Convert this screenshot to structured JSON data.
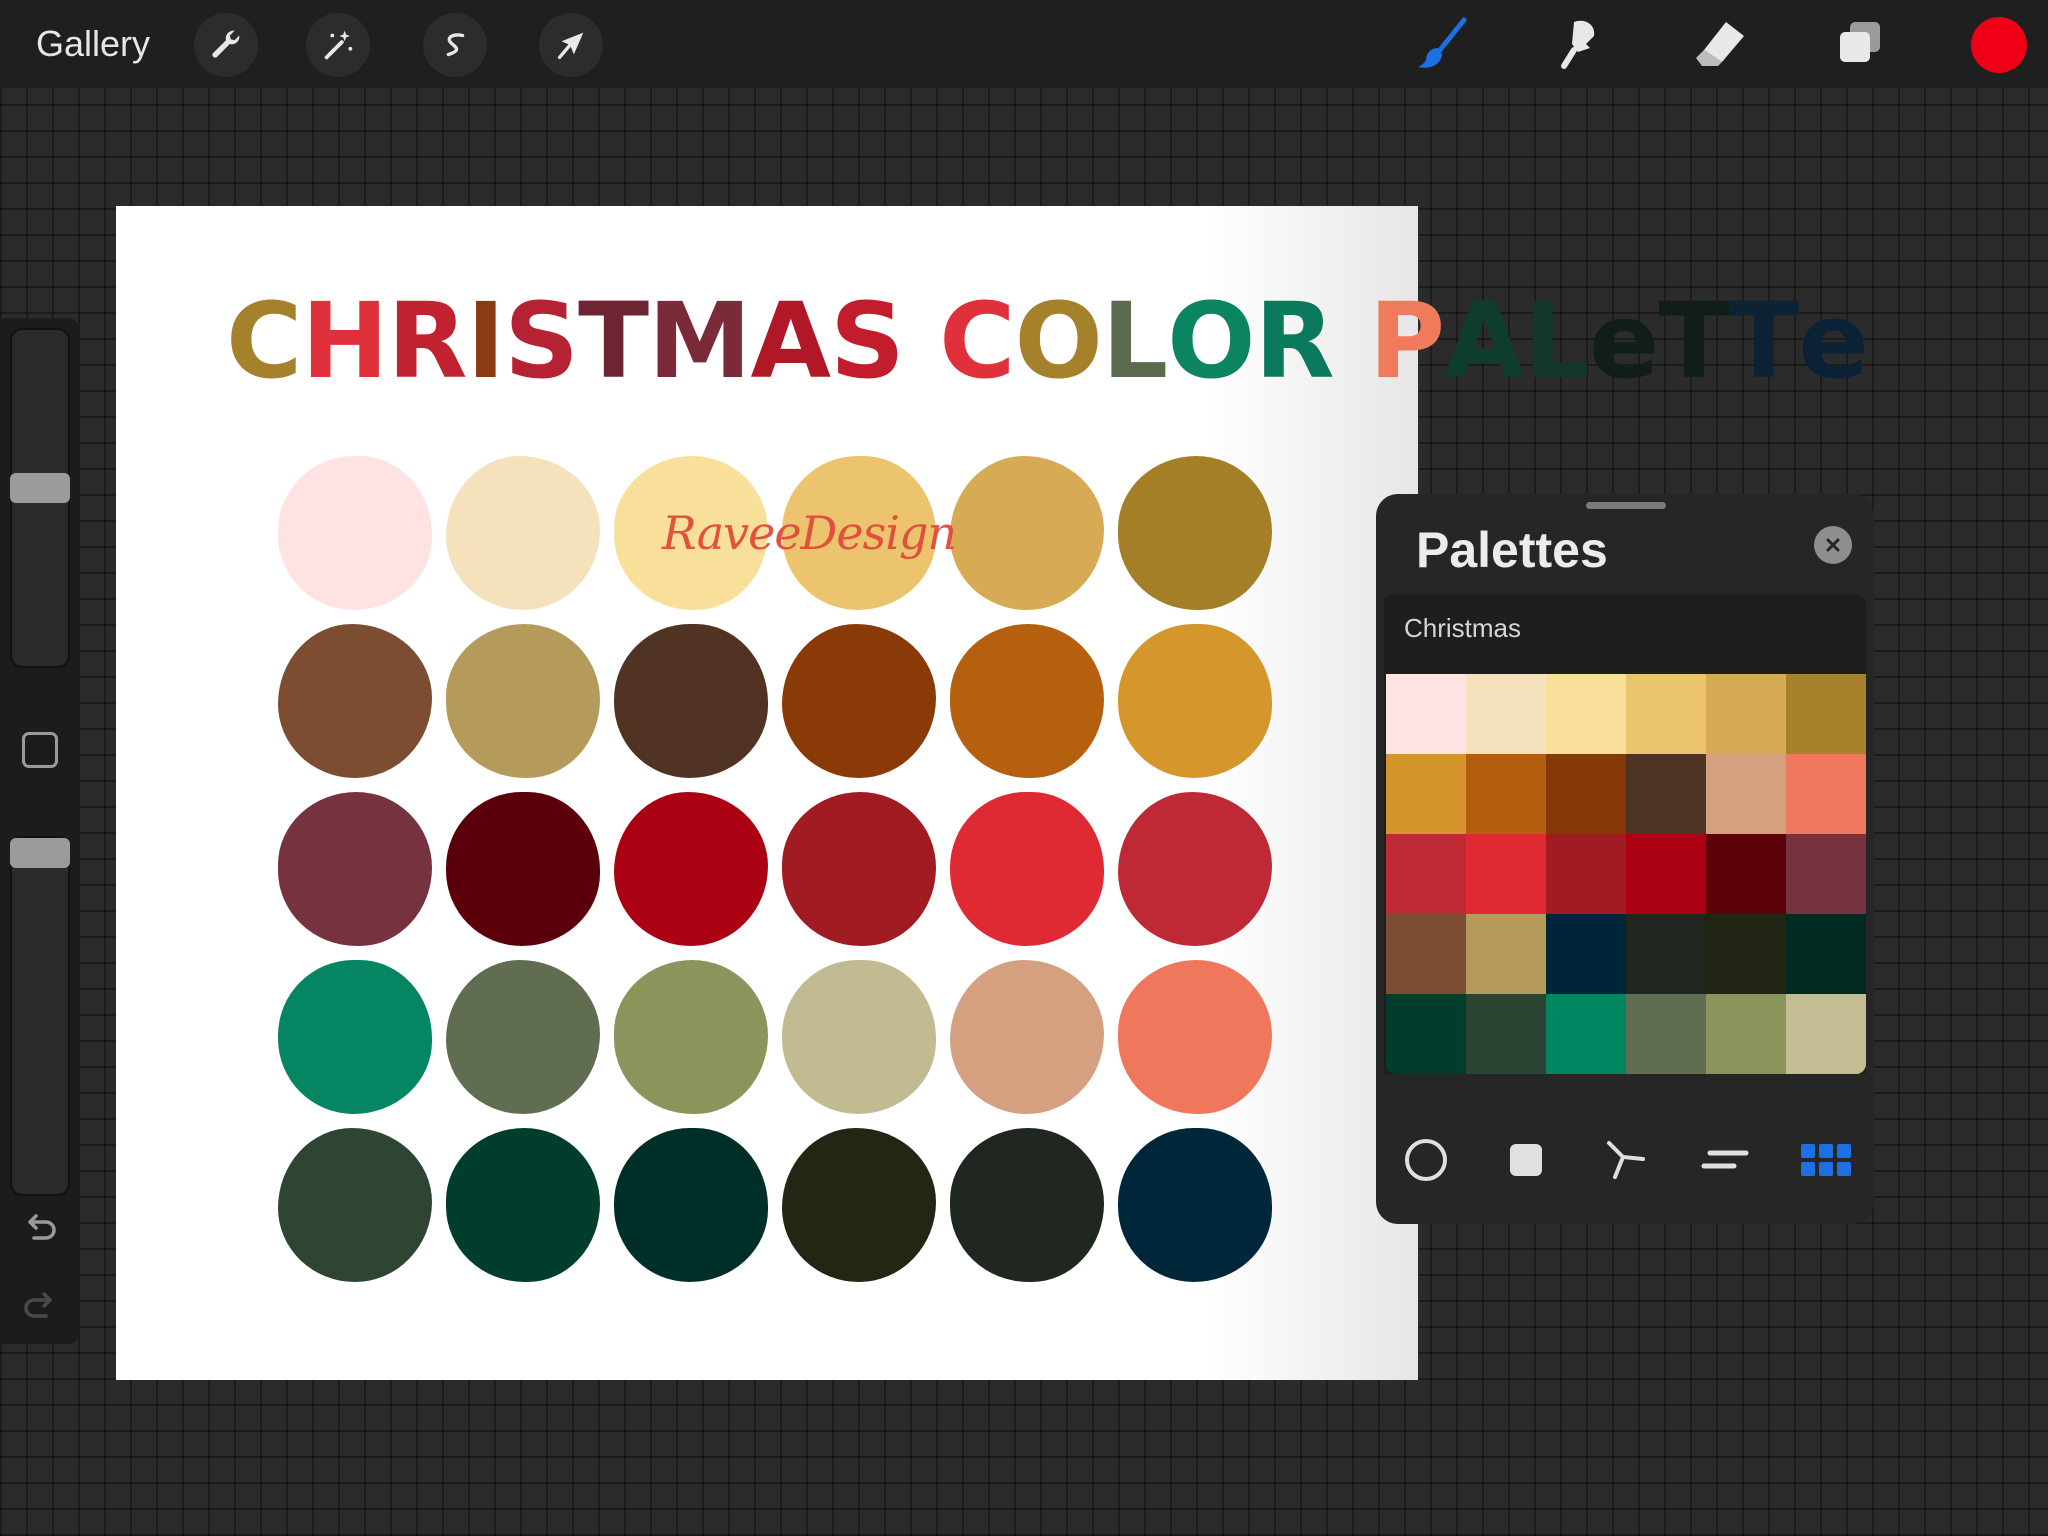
{
  "toolbar": {
    "gallery_label": "Gallery",
    "left_tools": [
      {
        "name": "wrench-icon",
        "role": "actions"
      },
      {
        "name": "magic-wand-icon",
        "role": "adjustments"
      },
      {
        "name": "selection-s-icon",
        "role": "selection"
      },
      {
        "name": "arrow-cursor-icon",
        "role": "transform"
      }
    ],
    "right_tools": [
      {
        "name": "brush-icon",
        "active": true
      },
      {
        "name": "smudge-icon",
        "active": false
      },
      {
        "name": "eraser-icon",
        "active": false
      },
      {
        "name": "layers-icon",
        "active": false
      }
    ],
    "current_color": "#f00016",
    "active_tool_color": "#1d6fe6"
  },
  "sidebar": {
    "brush_size_level": 0.47,
    "opacity_level": 0.0,
    "icons": [
      "modify-square-icon",
      "undo-icon",
      "redo-icon"
    ]
  },
  "canvas": {
    "title_segments": [
      {
        "text": "C",
        "color": "#a6812b"
      },
      {
        "text": "H",
        "color": "#e0303b"
      },
      {
        "text": "R",
        "color": "#c0232f"
      },
      {
        "text": "I",
        "color": "#8a3b12"
      },
      {
        "text": "S",
        "color": "#b42233"
      },
      {
        "text": "T",
        "color": "#6d2534"
      },
      {
        "text": "M",
        "color": "#7b2a37"
      },
      {
        "text": "A",
        "color": "#b01727"
      },
      {
        "text": "S ",
        "color": "#c31c2d"
      },
      {
        "text": "C",
        "color": "#e0303b"
      },
      {
        "text": "O",
        "color": "#a6812b"
      },
      {
        "text": "L",
        "color": "#5a6b4e"
      },
      {
        "text": "O",
        "color": "#0b8462"
      },
      {
        "text": "R ",
        "color": "#0b7a5c"
      },
      {
        "text": "P",
        "color": "#ef7a5c"
      },
      {
        "text": "A",
        "color": "#0f3d2c"
      },
      {
        "text": "L",
        "color": "#14352a"
      },
      {
        "text": "e",
        "color": "#101d1a"
      },
      {
        "text": "T",
        "color": "#101d1a"
      },
      {
        "text": "T",
        "color": "#0d2233"
      },
      {
        "text": "e",
        "color": "#0b2236"
      }
    ],
    "watermark": "RaveeDesign",
    "swatches": [
      [
        "#ffe2e2",
        "#f6e1bd",
        "#f8df9a",
        "#ecc46e",
        "#d7aa56",
        "#a47f28"
      ],
      [
        "#7c4d30",
        "#b59b5b",
        "#503323",
        "#8a3a07",
        "#b5600f",
        "#d5962c"
      ],
      [
        "#77323f",
        "#5b000a",
        "#ab0113",
        "#a01b22",
        "#e02a33",
        "#bf2835"
      ],
      [
        "#058562",
        "#616d51",
        "#89955b",
        "#c2bb92",
        "#d4a080",
        "#ef775c"
      ],
      [
        "#2d4532",
        "#003d2c",
        "#002e28",
        "#222714",
        "#202620",
        "#00263a"
      ]
    ]
  },
  "palettes_panel": {
    "title": "Palettes",
    "palette_name": "Christmas",
    "cells": [
      [
        "#ffe2e2",
        "#f6e1bd",
        "#f8df9a",
        "#ecc46e",
        "#d7aa56",
        "#a7812b"
      ],
      [
        "#d6952c",
        "#b35f0f",
        "#873807",
        "#4f3323",
        "#d4a080",
        "#f0785c"
      ],
      [
        "#c02a34",
        "#e02a33",
        "#a01b22",
        "#ab0113",
        "#5c000a",
        "#77323f"
      ],
      [
        "#7c4d30",
        "#b59b5b",
        "#00243a",
        "#202520",
        "#222514",
        "#002a22"
      ],
      [
        "#003d2d",
        "#2c4433",
        "#008762",
        "#616d51",
        "#89955b",
        "#c4bd93"
      ]
    ],
    "view_tabs": [
      {
        "name": "disc-view-icon",
        "active": false
      },
      {
        "name": "classic-view-icon",
        "active": false
      },
      {
        "name": "harmony-view-icon",
        "active": false
      },
      {
        "name": "value-view-icon",
        "active": false
      },
      {
        "name": "palettes-view-icon",
        "active": true
      }
    ]
  }
}
